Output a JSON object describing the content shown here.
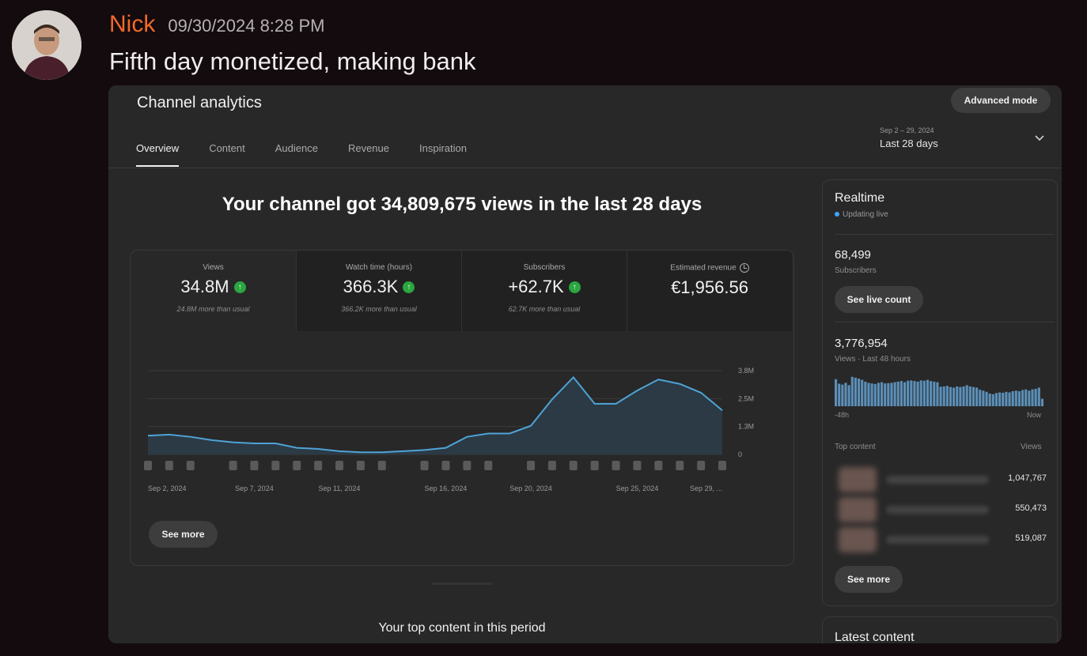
{
  "message": {
    "author": "Nick",
    "timestamp": "09/30/2024 8:28 PM",
    "text": "Fifth day monetized, making bank",
    "author_color": "#f06a2a"
  },
  "analytics": {
    "title": "Channel analytics",
    "advanced_mode_label": "Advanced mode",
    "tabs": [
      {
        "label": "Overview",
        "active": true
      },
      {
        "label": "Content",
        "active": false
      },
      {
        "label": "Audience",
        "active": false
      },
      {
        "label": "Revenue",
        "active": false
      },
      {
        "label": "Inspiration",
        "active": false
      }
    ],
    "date_range": {
      "dates": "Sep 2 – 29, 2024",
      "label": "Last 28 days"
    },
    "headline": "Your channel got 34,809,675 views in the last 28 days",
    "metrics": [
      {
        "label": "Views",
        "value": "34.8M",
        "trend_icon": "arrow-up-icon",
        "note": "24.8M more than usual"
      },
      {
        "label": "Watch time (hours)",
        "value": "366.3K",
        "trend_icon": "arrow-up-icon",
        "note": "366.2K more than usual"
      },
      {
        "label": "Subscribers",
        "value": "+62.7K",
        "trend_icon": "arrow-up-icon",
        "note": "62.7K more than usual"
      },
      {
        "label": "Estimated revenue",
        "value": "€1,956.56",
        "info_icon": "clock-icon"
      }
    ],
    "see_more_label": "See more",
    "top_content_title": "Your top content in this period",
    "realtime": {
      "title": "Realtime",
      "status": "Updating live",
      "subscribers_value": "68,499",
      "subscribers_label": "Subscribers",
      "see_live_count_label": "See live count",
      "views_value": "3,776,954",
      "views_label": "Views · Last 48 hours",
      "axis_start": "-48h",
      "axis_end": "Now",
      "bars": [
        0.9,
        0.75,
        0.72,
        0.78,
        0.7,
        0.98,
        0.95,
        0.92,
        0.88,
        0.82,
        0.78,
        0.76,
        0.74,
        0.78,
        0.8,
        0.76,
        0.77,
        0.78,
        0.8,
        0.82,
        0.84,
        0.8,
        0.85,
        0.86,
        0.84,
        0.82,
        0.86,
        0.85,
        0.88,
        0.84,
        0.82,
        0.8,
        0.65,
        0.66,
        0.68,
        0.64,
        0.62,
        0.66,
        0.64,
        0.66,
        0.7,
        0.66,
        0.64,
        0.62,
        0.55,
        0.52,
        0.48,
        0.42,
        0.4,
        0.44,
        0.46,
        0.45,
        0.48,
        0.46,
        0.5,
        0.52,
        0.5,
        0.54,
        0.56,
        0.52,
        0.56,
        0.58,
        0.62,
        0.25
      ],
      "top_content_header": "Top content",
      "top_content_views_header": "Views",
      "top_content": [
        {
          "views": "1,047,767"
        },
        {
          "views": "550,473"
        },
        {
          "views": "519,087"
        }
      ],
      "see_more_label": "See more",
      "accent_color": "#3ea6ff"
    },
    "latest_content_title": "Latest content"
  },
  "chart_data": {
    "type": "area",
    "title": "",
    "xlabel": "",
    "ylabel": "",
    "x": [
      "Sep 2",
      "Sep 3",
      "Sep 4",
      "Sep 5",
      "Sep 6",
      "Sep 7",
      "Sep 8",
      "Sep 9",
      "Sep 10",
      "Sep 11",
      "Sep 12",
      "Sep 13",
      "Sep 14",
      "Sep 15",
      "Sep 16",
      "Sep 17",
      "Sep 18",
      "Sep 19",
      "Sep 20",
      "Sep 21",
      "Sep 22",
      "Sep 23",
      "Sep 24",
      "Sep 25",
      "Sep 26",
      "Sep 27",
      "Sep 28",
      "Sep 29"
    ],
    "series": [
      {
        "values": [
          0.85,
          0.9,
          0.8,
          0.65,
          0.55,
          0.5,
          0.5,
          0.3,
          0.25,
          0.15,
          0.1,
          0.1,
          0.15,
          0.2,
          0.3,
          0.8,
          0.95,
          0.95,
          1.3,
          2.5,
          3.5,
          2.3,
          2.3,
          2.9,
          3.4,
          3.2,
          2.8,
          2.0
        ]
      }
    ],
    "x_tick_labels": [
      "Sep 2, 2024",
      "Sep 7, 2024",
      "Sep 11, 2024",
      "Sep 16, 2024",
      "Sep 20, 2024",
      "Sep 25, 2024",
      "Sep 29, ..."
    ],
    "y_tick_labels": [
      "3.8M",
      "2.5M",
      "1.3M",
      "0"
    ],
    "ylim": [
      0,
      3.8
    ],
    "grid": true,
    "fill_color": "#2b3a45",
    "line_color": "#4ea3d6"
  }
}
